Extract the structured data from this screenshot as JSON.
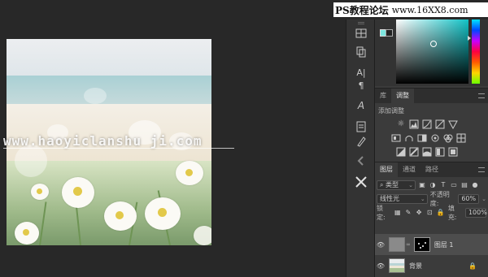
{
  "site_banner": {
    "name_cn": "PS教程论坛",
    "url": "www.16XX8.com"
  },
  "watermark": {
    "url": "www.haoyiclanshu ji.com"
  },
  "color_panel": {
    "fg_color": "#7de6df",
    "bg_color": "#222222",
    "picker_hue": "#12c3c7"
  },
  "adjustments_panel": {
    "tabs": [
      "库",
      "调整"
    ],
    "active_tab": "调整",
    "title": "添加调整"
  },
  "layers_panel": {
    "tabs": [
      "图层",
      "通道",
      "路径"
    ],
    "active_tab": "图层",
    "filter_kind": "类型",
    "blend_mode": "线性光",
    "opacity_label": "不透明度:",
    "opacity_value": "60%",
    "lock_label": "锁定:",
    "fill_label": "填充:",
    "fill_value": "100%",
    "layers": [
      {
        "name": "图层 1",
        "selected": true,
        "has_mask": true
      },
      {
        "name": "背景",
        "selected": false,
        "locked": true
      }
    ]
  },
  "toolstrip_icons": [
    "swatches-icon",
    "clone-source-icon",
    "character-icon",
    "paragraph-icon",
    "glyph-icon",
    "notes-icon",
    "brush-preset-icon",
    "tool-presets-icon"
  ]
}
